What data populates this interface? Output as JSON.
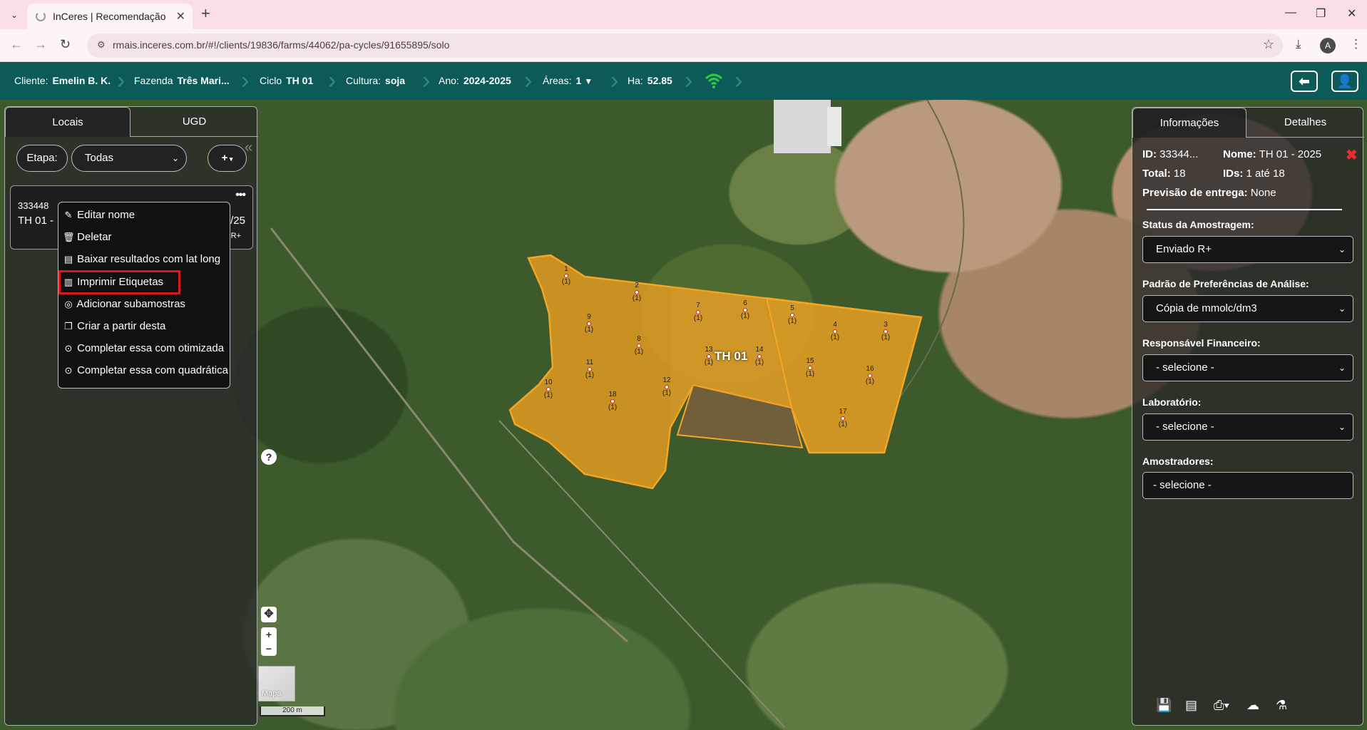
{
  "browser": {
    "tab_title": "InCeres | Recomendação",
    "url": "rmais.inceres.com.br/#!/clients/19836/farms/44062/pa-cycles/91655895/solo",
    "profile_initial": "A"
  },
  "header": {
    "cliente_label": "Cliente:",
    "cliente_value": "Emelin B. K.",
    "fazenda_label": "Fazenda",
    "fazenda_value": "Três Mari...",
    "ciclo_label": "Ciclo",
    "ciclo_value": "TH 01",
    "cultura_label": "Cultura:",
    "cultura_value": "soja",
    "ano_label": "Ano:",
    "ano_value": "2024-2025",
    "areas_label": "Áreas:",
    "areas_value": "1",
    "ha_label": "Ha:",
    "ha_value": "52.85",
    "wifi_color": "#2ecc40"
  },
  "left": {
    "tabs": [
      "Locais",
      "UGD"
    ],
    "etapa_label": "Etapa:",
    "etapa_value": "Todas",
    "add_label": "+",
    "card": {
      "id": "333448",
      "name": "TH 01 -",
      "year_suffix": "/25",
      "status_suffix": "R+"
    },
    "menu": [
      {
        "icon": "pencil-icon",
        "glyph": "✎",
        "label": "Editar nome"
      },
      {
        "icon": "trash-icon",
        "glyph": "🗑",
        "label": "Deletar"
      },
      {
        "icon": "file-excel-icon",
        "glyph": "▤",
        "label": "Baixar resultados com lat long"
      },
      {
        "icon": "barcode-icon",
        "glyph": "▥",
        "label": "Imprimir Etiquetas"
      },
      {
        "icon": "target-icon",
        "glyph": "◎",
        "label": "Adicionar subamostras"
      },
      {
        "icon": "copy-icon",
        "glyph": "❐",
        "label": "Criar a partir desta"
      },
      {
        "icon": "dot-circle-icon",
        "glyph": "⊙",
        "label": "Completar essa com otimizada"
      },
      {
        "icon": "dot-circle-icon",
        "glyph": "⊙",
        "label": "Completar essa com quadrática"
      }
    ],
    "highlight_color": "#d7191c"
  },
  "map": {
    "field_label": "TH 01",
    "field_color": "#f0a020",
    "points": [
      {
        "n": "1",
        "c": "(1)"
      },
      {
        "n": "2",
        "c": "(1)"
      },
      {
        "n": "3",
        "c": "(1)"
      },
      {
        "n": "4",
        "c": "(1)"
      },
      {
        "n": "5",
        "c": "(1)"
      },
      {
        "n": "6",
        "c": "(1)"
      },
      {
        "n": "7",
        "c": "(1)"
      },
      {
        "n": "8",
        "c": "(1)"
      },
      {
        "n": "9",
        "c": "(1)"
      },
      {
        "n": "10",
        "c": "(1)"
      },
      {
        "n": "11",
        "c": "(1)"
      },
      {
        "n": "12",
        "c": "(1)"
      },
      {
        "n": "13",
        "c": "(1)"
      },
      {
        "n": "14",
        "c": "(1)"
      },
      {
        "n": "15",
        "c": "(1)"
      },
      {
        "n": "16",
        "c": "(1)"
      },
      {
        "n": "17",
        "c": "(1)"
      },
      {
        "n": "18",
        "c": "(1)"
      }
    ],
    "help_label": "?",
    "zoom_in": "+",
    "zoom_out": "−",
    "layer_label": "Mapa",
    "scale_label": "200 m"
  },
  "right": {
    "tabs": [
      "Informações",
      "Detalhes"
    ],
    "id_label": "ID:",
    "id_value": "33344...",
    "nome_label": "Nome:",
    "nome_value": "TH 01 - 2025",
    "total_label": "Total:",
    "total_value": "18",
    "ids_label": "IDs:",
    "ids_value": "1 até 18",
    "previsao_label": "Previsão de entrega:",
    "previsao_value": "None",
    "status_label": "Status da Amostragem:",
    "status_value": "Enviado R+",
    "padrao_label": "Padrão de Preferências de Análise:",
    "padrao_value": "Cópia de mmolc/dm3",
    "financeiro_label": "Responsável Financeiro:",
    "financeiro_value": "- selecione -",
    "laboratorio_label": "Laboratório:",
    "laboratorio_value": "- selecione -",
    "amostradores_label": "Amostradores:",
    "amostradores_value": "- selecione -"
  }
}
